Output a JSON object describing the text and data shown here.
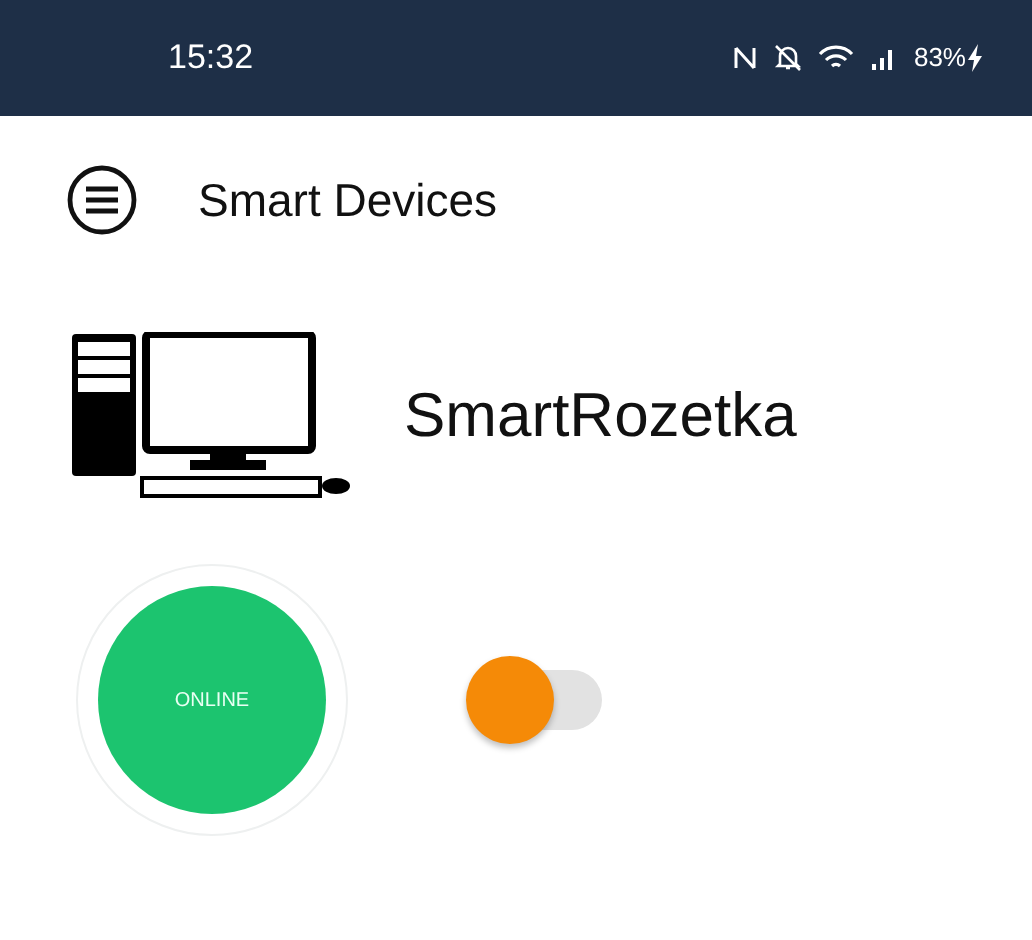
{
  "status_bar": {
    "time": "15:32",
    "battery": "83%"
  },
  "app_bar": {
    "title": "Smart Devices"
  },
  "device": {
    "name": "SmartRozetka",
    "status": "ONLINE",
    "power_switch": {
      "on": false
    }
  }
}
